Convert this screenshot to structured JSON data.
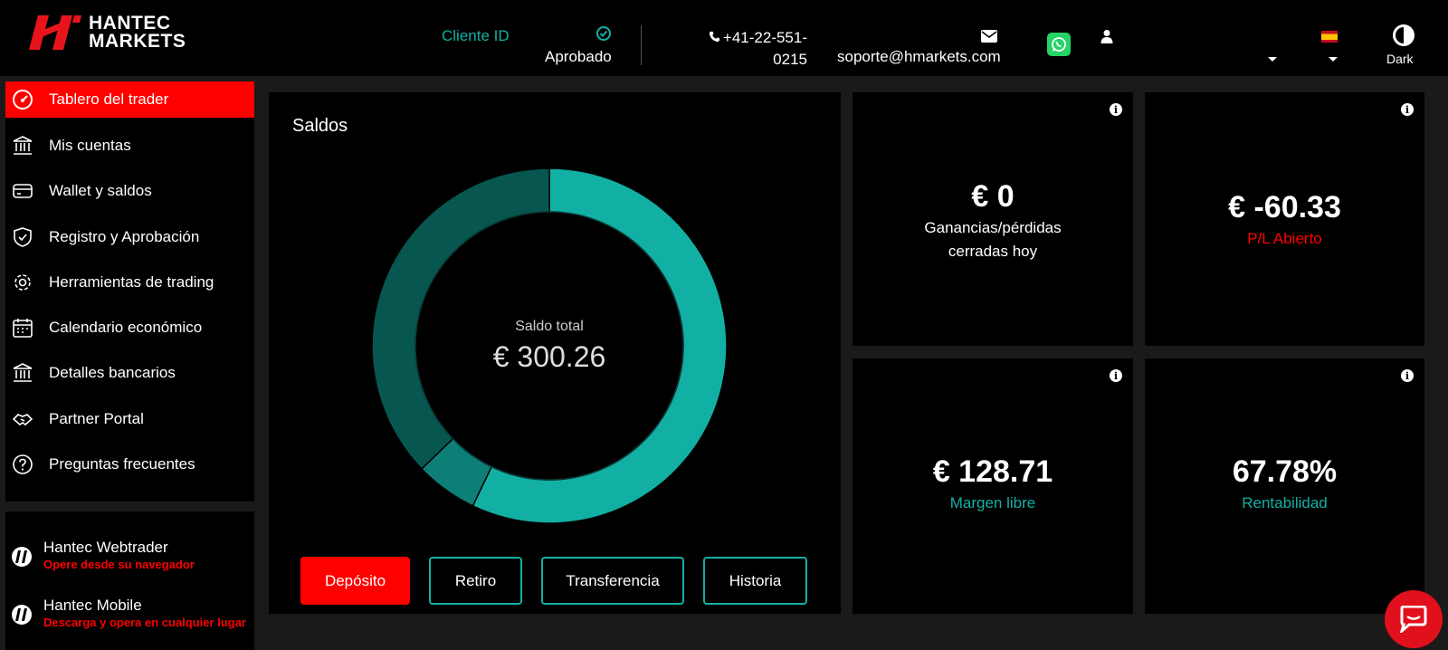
{
  "header": {
    "logo_line1": "HANTEC",
    "logo_line2": "MARKETS",
    "cliente_label": "Cliente ID",
    "cliente_status": "Aprobado",
    "phone": "+41-22-551-0215",
    "email": "soporte@hmarkets.com",
    "theme_label": "Dark"
  },
  "sidebar": {
    "items": [
      {
        "label": "Tablero del trader",
        "icon": "dashboard-icon"
      },
      {
        "label": "Mis cuentas",
        "icon": "bank-icon"
      },
      {
        "label": "Wallet y saldos",
        "icon": "wallet-icon"
      },
      {
        "label": "Registro y Aprobación",
        "icon": "shield-icon"
      },
      {
        "label": "Herramientas de trading",
        "icon": "gear-icon"
      },
      {
        "label": "Calendario económico",
        "icon": "calendar-icon"
      },
      {
        "label": "Detalles bancarios",
        "icon": "bank-icon"
      },
      {
        "label": "Partner Portal",
        "icon": "handshake-icon"
      },
      {
        "label": "Preguntas frecuentes",
        "icon": "question-icon"
      }
    ],
    "apps": [
      {
        "title": "Hantec Webtrader",
        "subtitle": "Opere desde su navegador"
      },
      {
        "title": "Hantec Mobile",
        "subtitle": "Descarga y opera en cualquier lugar"
      }
    ]
  },
  "balances": {
    "title": "Saldos",
    "total_label": "Saldo total",
    "total_value": "€ 300.26",
    "buttons": {
      "deposit": "Depósito",
      "withdraw": "Retiro",
      "transfer": "Transferencia",
      "history": "Historia"
    }
  },
  "cards": {
    "closed_pl": {
      "value": "€ 0",
      "label": "Ganancias/pérdidas cerradas hoy"
    },
    "open_pl": {
      "value": "€ -60.33",
      "label": "P/L Abierto"
    },
    "free_margin": {
      "value": "€ 128.71",
      "label": "Margen libre"
    },
    "profitability": {
      "value": "67.78%",
      "label": "Rentabilidad"
    }
  },
  "colors": {
    "accent": "#12b0a4",
    "danger": "#ff0000",
    "donut_dark": "#075750",
    "donut_mid": "#0e7f76",
    "donut_main": "#12b0a4"
  },
  "chart_data": {
    "type": "pie",
    "values": [
      0.571,
      0.057,
      0.372
    ]
  }
}
